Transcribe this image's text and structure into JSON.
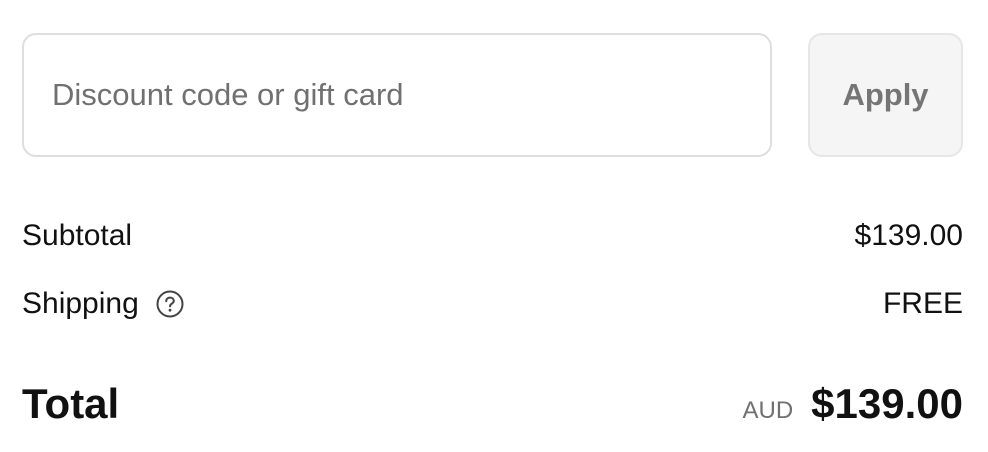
{
  "discount": {
    "placeholder": "Discount code or gift card",
    "value": "",
    "apply_label": "Apply"
  },
  "summary": {
    "subtotal_label": "Subtotal",
    "subtotal_value": "$139.00",
    "shipping_label": "Shipping",
    "shipping_help_icon": "question-circle-icon",
    "shipping_value": "FREE",
    "total_label": "Total",
    "currency": "AUD",
    "total_value": "$139.00"
  },
  "colors": {
    "input_border": "#dedede",
    "button_background": "#f5f5f5",
    "button_text": "#757575",
    "muted_text": "#707070",
    "text": "#111111"
  }
}
